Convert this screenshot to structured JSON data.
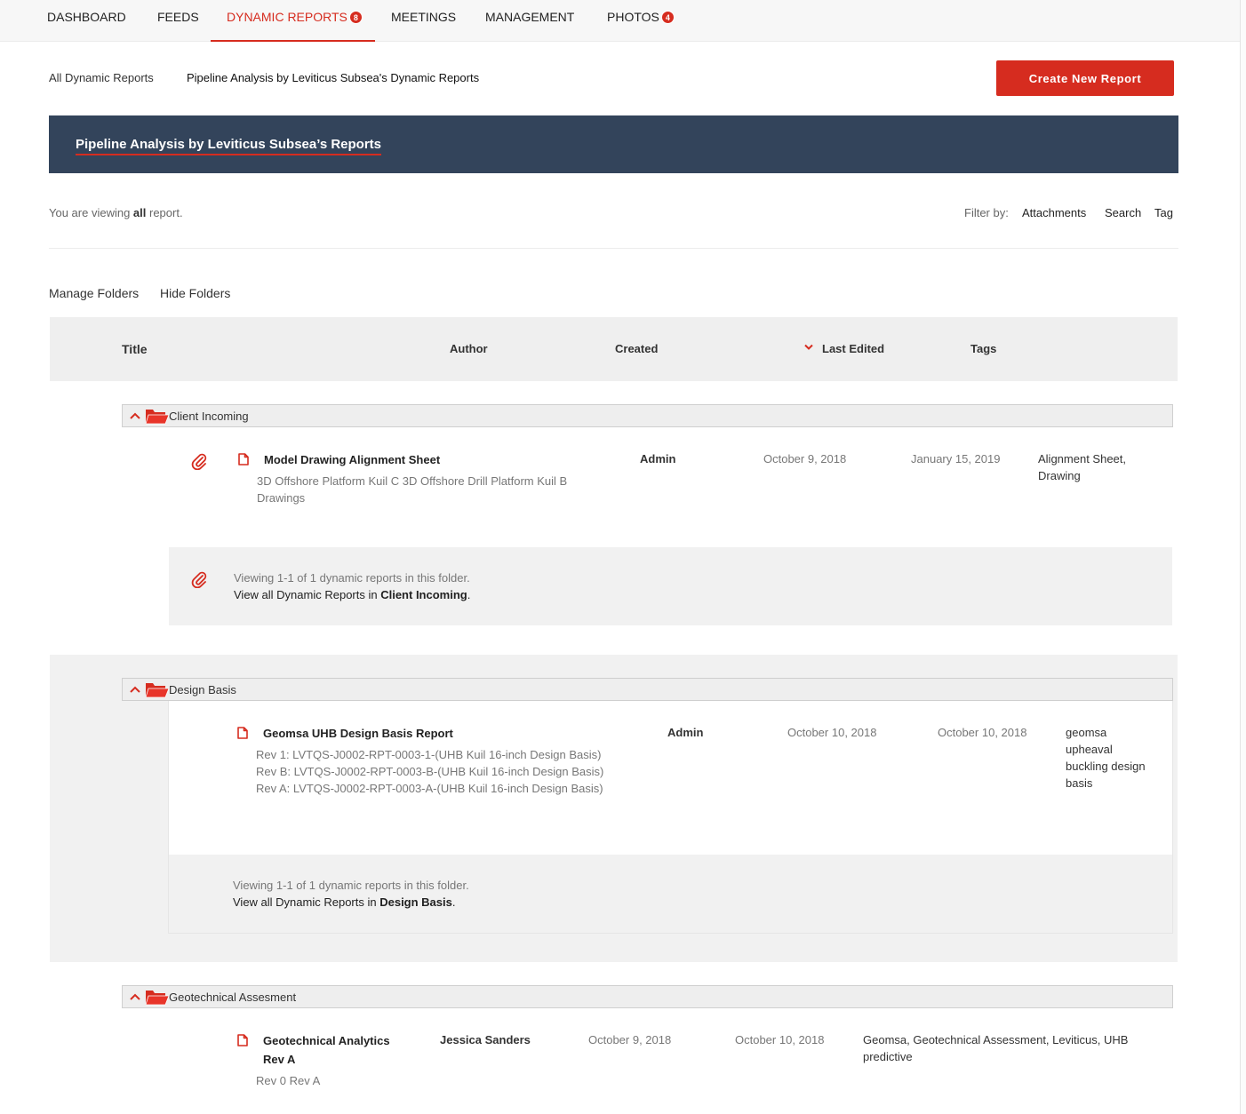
{
  "nav": {
    "items": [
      {
        "label": "DASHBOARD"
      },
      {
        "label": "FEEDS"
      },
      {
        "label": "DYNAMIC REPORTS",
        "badge": "8"
      },
      {
        "label": "MEETINGS"
      },
      {
        "label": "MANAGEMENT"
      },
      {
        "label": "PHOTOS",
        "badge": "4"
      }
    ]
  },
  "breadcrumb": {
    "root": "All Dynamic Reports",
    "current": "Pipeline Analysis by Leviticus Subsea's Dynamic Reports"
  },
  "create_button": "Create New Report",
  "banner": {
    "title": "Pipeline Analysis by Leviticus Subsea’s Reports"
  },
  "viewing": {
    "prefix": "You are viewing ",
    "scope": "all",
    "suffix": " report."
  },
  "filter": {
    "label": "Filter by:",
    "options": [
      "Attachments",
      "Search",
      "Tag"
    ]
  },
  "folder_actions": {
    "manage": "Manage Folders",
    "hide": "Hide Folders"
  },
  "table": {
    "columns": {
      "title": "Title",
      "author": "Author",
      "created": "Created",
      "last_edited": "Last Edited",
      "tags": "Tags"
    }
  },
  "folders": [
    {
      "name": "Client Incoming",
      "reports": [
        {
          "title": "Model Drawing Alignment Sheet",
          "description": "3D Offshore Platform Kuil C 3D Offshore Drill Platform Kuil B Drawings",
          "author": "Admin",
          "created": "October 9, 2018",
          "last_edited": "January 15, 2019",
          "tags": "Alignment Sheet, Drawing"
        }
      ],
      "footer": {
        "count": "Viewing 1-1 of 1 dynamic reports in this folder.",
        "prefix": "View all Dynamic Reports in ",
        "link": "Client Incoming",
        "suffix": "."
      }
    },
    {
      "name": "Design Basis",
      "reports": [
        {
          "title": "Geomsa UHB Design Basis Report",
          "description": "Rev 1: LVTQS-J0002-RPT-0003-1-(UHB Kuil 16-inch Design Basis) Rev B: LVTQS-J0002-RPT-0003-B-(UHB Kuil 16-inch Design Basis) Rev A: LVTQS-J0002-RPT-0003-A-(UHB Kuil 16-inch Design Basis)",
          "author": "Admin",
          "created": "October 10, 2018",
          "last_edited": "October 10, 2018",
          "tags": "geomsa upheaval buckling design basis"
        }
      ],
      "footer": {
        "count": "Viewing 1-1 of 1 dynamic reports in this folder.",
        "prefix": "View all Dynamic Reports in ",
        "link": "Design Basis",
        "suffix": "."
      }
    },
    {
      "name": "Geotechnical Assesment",
      "reports": [
        {
          "title": "Geotechnical Analytics Rev A",
          "description": "Rev 0 Rev A",
          "author": "Jessica Sanders",
          "created": "October 9, 2018",
          "last_edited": "October 10, 2018",
          "tags": "Geomsa, Geotechnical Assessment, Leviticus, UHB predictive"
        }
      ]
    }
  ],
  "colors": {
    "accent": "#d62c1f",
    "banner": "#33445b",
    "header_bg": "#efefef"
  },
  "icons": [
    "chevron-up-icon",
    "folder-open-icon",
    "paperclip-icon",
    "document-icon",
    "sort-down-icon"
  ]
}
